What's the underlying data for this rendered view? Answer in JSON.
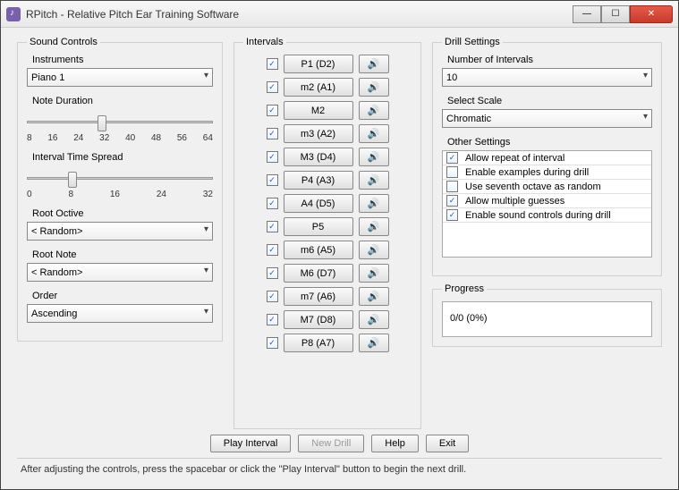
{
  "window": {
    "title": "RPitch - Relative Pitch Ear Training Software"
  },
  "sound_controls": {
    "legend": "Sound Controls",
    "instruments_label": "Instruments",
    "instrument": "Piano 1",
    "note_duration_label": "Note Duration",
    "note_duration_ticks": [
      "8",
      "16",
      "24",
      "32",
      "40",
      "48",
      "56",
      "64"
    ],
    "interval_spread_label": "Interval Time Spread",
    "interval_spread_ticks": [
      "0",
      "8",
      "16",
      "24",
      "32"
    ],
    "root_octive_label": "Root Octive",
    "root_octive": "< Random>",
    "root_note_label": "Root Note",
    "root_note": "< Random>",
    "order_label": "Order",
    "order": "Ascending"
  },
  "intervals": {
    "legend": "Intervals",
    "items": [
      {
        "label": "P1 (D2)",
        "checked": true
      },
      {
        "label": "m2 (A1)",
        "checked": true
      },
      {
        "label": "M2",
        "checked": true
      },
      {
        "label": "m3 (A2)",
        "checked": true
      },
      {
        "label": "M3 (D4)",
        "checked": true
      },
      {
        "label": "P4 (A3)",
        "checked": true
      },
      {
        "label": "A4 (D5)",
        "checked": true
      },
      {
        "label": "P5",
        "checked": true
      },
      {
        "label": "m6 (A5)",
        "checked": true
      },
      {
        "label": "M6 (D7)",
        "checked": true
      },
      {
        "label": "m7 (A6)",
        "checked": true
      },
      {
        "label": "M7 (D8)",
        "checked": true
      },
      {
        "label": "P8 (A7)",
        "checked": true
      }
    ]
  },
  "drill": {
    "legend": "Drill Settings",
    "num_label": "Number of Intervals",
    "num_value": "10",
    "scale_label": "Select Scale",
    "scale_value": "Chromatic",
    "other_label": "Other Settings",
    "settings": [
      {
        "label": "Allow repeat of interval",
        "checked": true
      },
      {
        "label": "Enable examples during drill",
        "checked": false
      },
      {
        "label": "Use seventh octave as random",
        "checked": false
      },
      {
        "label": "Allow multiple guesses",
        "checked": true
      },
      {
        "label": "Enable sound controls during drill",
        "checked": true
      }
    ]
  },
  "progress": {
    "legend": "Progress",
    "text": "0/0 (0%)"
  },
  "buttons": {
    "play": "Play Interval",
    "newdrill": "New Drill",
    "help": "Help",
    "exit": "Exit"
  },
  "status": "After adjusting the controls, press the spacebar or click the \"Play Interval\" button to begin the next drill."
}
